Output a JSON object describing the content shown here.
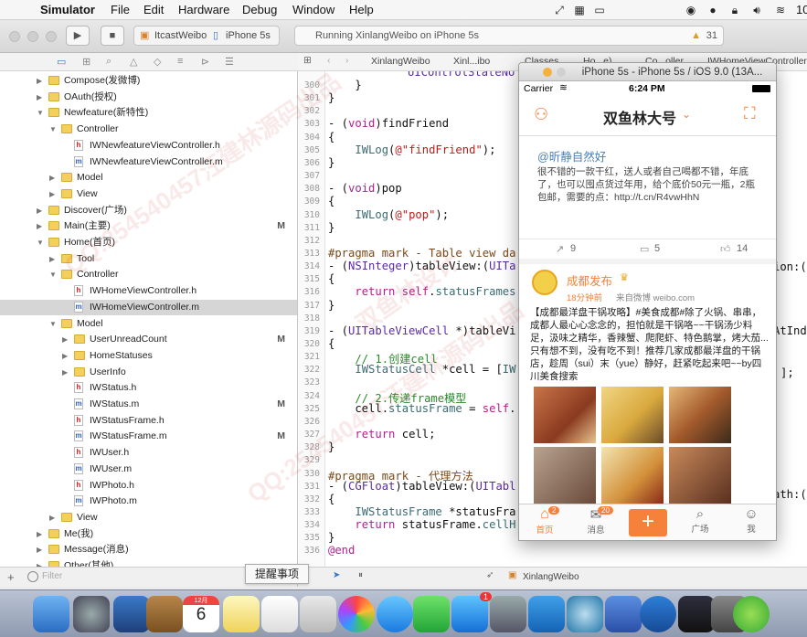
{
  "menubar": {
    "app": "Simulator",
    "items": [
      "File",
      "Edit",
      "Hardware",
      "Debug",
      "Window",
      "Help"
    ],
    "clock_partial": "10"
  },
  "toolbar": {
    "scheme_target": "ItcastWeibo",
    "scheme_device": "iPhone 5s",
    "status_text": "Running XinlangWeibo on iPhone 5s",
    "warning_count": "31"
  },
  "jumpbar": {
    "crumbs": [
      "XinlangWeibo",
      "Xinl...ibo",
      "Classes",
      "Ho...e)",
      "Co...oller",
      "IWHomeViewController..."
    ]
  },
  "navigator": {
    "rows": [
      {
        "label": "Compose(发微博)",
        "type": "folder",
        "indent": 1,
        "tri": "closed",
        "mark": ""
      },
      {
        "label": "OAuth(授权)",
        "type": "folder",
        "indent": 1,
        "tri": "closed",
        "mark": ""
      },
      {
        "label": "Newfeature(新特性)",
        "type": "folder",
        "indent": 1,
        "tri": "open",
        "mark": ""
      },
      {
        "label": "Controller",
        "type": "folder",
        "indent": 2,
        "tri": "open",
        "mark": ""
      },
      {
        "label": "IWNewfeatureViewController.h",
        "type": "h",
        "indent": 3,
        "tri": "",
        "mark": ""
      },
      {
        "label": "IWNewfeatureViewController.m",
        "type": "m",
        "indent": 3,
        "tri": "",
        "mark": ""
      },
      {
        "label": "Model",
        "type": "folder",
        "indent": 2,
        "tri": "closed",
        "mark": ""
      },
      {
        "label": "View",
        "type": "folder",
        "indent": 2,
        "tri": "closed",
        "mark": ""
      },
      {
        "label": "Discover(广场)",
        "type": "folder",
        "indent": 1,
        "tri": "closed",
        "mark": ""
      },
      {
        "label": "Main(主要)",
        "type": "folder",
        "indent": 1,
        "tri": "closed",
        "mark": "M"
      },
      {
        "label": "Home(首页)",
        "type": "folder",
        "indent": 1,
        "tri": "open",
        "mark": ""
      },
      {
        "label": "Tool",
        "type": "folder",
        "indent": 2,
        "tri": "closed",
        "mark": ""
      },
      {
        "label": "Controller",
        "type": "folder",
        "indent": 2,
        "tri": "open",
        "mark": ""
      },
      {
        "label": "IWHomeViewController.h",
        "type": "h",
        "indent": 3,
        "tri": "",
        "mark": ""
      },
      {
        "label": "IWHomeViewController.m",
        "type": "m",
        "indent": 3,
        "tri": "",
        "mark": "",
        "selected": true
      },
      {
        "label": "Model",
        "type": "folder",
        "indent": 2,
        "tri": "open",
        "mark": ""
      },
      {
        "label": "UserUnreadCount",
        "type": "folder",
        "indent": 3,
        "tri": "closed",
        "mark": "M"
      },
      {
        "label": "HomeStatuses",
        "type": "folder",
        "indent": 3,
        "tri": "closed",
        "mark": ""
      },
      {
        "label": "UserInfo",
        "type": "folder",
        "indent": 3,
        "tri": "closed",
        "mark": ""
      },
      {
        "label": "IWStatus.h",
        "type": "h",
        "indent": 3,
        "tri": "",
        "mark": ""
      },
      {
        "label": "IWStatus.m",
        "type": "m",
        "indent": 3,
        "tri": "",
        "mark": "M"
      },
      {
        "label": "IWStatusFrame.h",
        "type": "h",
        "indent": 3,
        "tri": "",
        "mark": ""
      },
      {
        "label": "IWStatusFrame.m",
        "type": "m",
        "indent": 3,
        "tri": "",
        "mark": "M"
      },
      {
        "label": "IWUser.h",
        "type": "h",
        "indent": 3,
        "tri": "",
        "mark": ""
      },
      {
        "label": "IWUser.m",
        "type": "m",
        "indent": 3,
        "tri": "",
        "mark": ""
      },
      {
        "label": "IWPhoto.h",
        "type": "h",
        "indent": 3,
        "tri": "",
        "mark": ""
      },
      {
        "label": "IWPhoto.m",
        "type": "m",
        "indent": 3,
        "tri": "",
        "mark": ""
      },
      {
        "label": "View",
        "type": "folder",
        "indent": 2,
        "tri": "closed",
        "mark": ""
      },
      {
        "label": "Me(我)",
        "type": "folder",
        "indent": 1,
        "tri": "closed",
        "mark": ""
      },
      {
        "label": "Message(消息)",
        "type": "folder",
        "indent": 1,
        "tri": "closed",
        "mark": ""
      },
      {
        "label": "Other(其他)",
        "type": "folder",
        "indent": 1,
        "tri": "closed",
        "mark": ""
      }
    ],
    "filter_placeholder": "Filter"
  },
  "editor": {
    "lines": [
      {
        "n": "300",
        "html": "    }"
      },
      {
        "n": "301",
        "html": "}"
      },
      {
        "n": "302",
        "html": ""
      },
      {
        "n": "303",
        "html": "- (<span class='kw'>void</span>)findFriend"
      },
      {
        "n": "304",
        "html": "{"
      },
      {
        "n": "305",
        "html": "    <span class='mv'>IWLog</span>(<span class='str'>@\"findFriend\"</span>);"
      },
      {
        "n": "306",
        "html": "}"
      },
      {
        "n": "307",
        "html": ""
      },
      {
        "n": "308",
        "html": "- (<span class='kw'>void</span>)pop"
      },
      {
        "n": "309",
        "html": "{"
      },
      {
        "n": "310",
        "html": "    <span class='mv'>IWLog</span>(<span class='str'>@\"pop\"</span>);"
      },
      {
        "n": "311",
        "html": "}"
      },
      {
        "n": "312",
        "html": ""
      },
      {
        "n": "313",
        "html": "<span class='pr'>#pragma mark - Table view da</span>"
      },
      {
        "n": "314",
        "html": "- (<span class='ty'>NSInteger</span>)tableView:(<span class='ty'>UITa</span>"
      },
      {
        "n": "315",
        "html": "{"
      },
      {
        "n": "316",
        "html": "    <span class='kw'>return</span> <span class='kw'>self</span>.<span class='mv'>statusFrames</span>"
      },
      {
        "n": "317",
        "html": "}"
      },
      {
        "n": "318",
        "html": ""
      },
      {
        "n": "319",
        "html": "- (<span class='ty'>UITableViewCell</span> *)tableVi"
      },
      {
        "n": "320",
        "html": "{"
      },
      {
        "n": "321",
        "html": "    <span class='cm'>// 1.创建cell</span>"
      },
      {
        "n": "322",
        "html": "    <span class='mv'>IWStatusCell</span> *cell = [<span class='mv'>IW</span>"
      },
      {
        "n": "323",
        "html": ""
      },
      {
        "n": "324",
        "html": "    <span class='cm'>// 2.传递frame模型</span>"
      },
      {
        "n": "325",
        "html": "    cell.<span class='mv'>statusFrame</span> = <span class='kw'>self</span>."
      },
      {
        "n": "326",
        "html": ""
      },
      {
        "n": "327",
        "html": "    <span class='kw'>return</span> cell;"
      },
      {
        "n": "328",
        "html": "}"
      },
      {
        "n": "329",
        "html": ""
      },
      {
        "n": "330",
        "html": "<span class='pr'>#pragma mark - 代理方法</span>"
      },
      {
        "n": "331",
        "html": "- (<span class='ty'>CGFloat</span>)tableView:(<span class='ty'>UITabl</span>"
      },
      {
        "n": "332",
        "html": "{"
      },
      {
        "n": "333",
        "html": "    <span class='mv'>IWStatusFrame</span> *statusFra"
      },
      {
        "n": "334",
        "html": "    <span class='kw'>return</span> statusFrame.<span class='mv'>cellH</span>"
      },
      {
        "n": "335",
        "html": "}"
      },
      {
        "n": "336",
        "html": "<span class='kw'>@end</span>"
      }
    ],
    "right_fragments": {
      "l299": "UIControlStateNo",
      "l314": "ion:(",
      "l319": "AtInd",
      "l322": "];",
      "l331": "ath:("
    }
  },
  "debugbar": {
    "target": "XinlangWeibo"
  },
  "tooltip": "提醒事项",
  "simulator": {
    "title": "iPhone 5s - iPhone 5s / iOS 9.0 (13A...",
    "carrier": "Carrier",
    "time": "6:24 PM",
    "nav_title": "双鱼林大号",
    "card1": {
      "user": "@昕静自然好",
      "text": "很不错的一款干红，送人或者自己喝都不错，年底了，也可以囤点货过年用，给个底价50元一瓶，2瓶包邮，需要的点：http://t.cn/R4vwHhN",
      "reposts": "9",
      "comments": "5",
      "likes": "14"
    },
    "card2": {
      "name": "成都发布",
      "time": "18分钟前",
      "source": "来自微博 weibo.com",
      "text": "【成都最洋盘干锅攻略】#美食成都#除了火锅、串串，成都人最心心念念的，担怕就是干锅咯~~干锅汤少料足，汲味之精华，香辣蟹、爬爬虾、特色鹅掌，烤大茄...只有想不到，没有吃不到！推荐几家成都最洋盘的干锅店，趁周（sui）末（yue）静好，赶紧吃起来吧~~by四川美食搜索"
    },
    "tabs": [
      {
        "label": "首页",
        "badge": "2"
      },
      {
        "label": "消息",
        "badge": "20"
      },
      {
        "label": "",
        "badge": ""
      },
      {
        "label": "广场",
        "badge": ""
      },
      {
        "label": "我",
        "badge": ""
      }
    ]
  },
  "dock": {
    "calendar_month": "12月",
    "calendar_day": "6",
    "appstore_badge": "1"
  },
  "watermark": [
    "QQ:254540457汪建林源码出品",
    "双鱼林设计",
    "QQ:254540457汪建林源码出品"
  ],
  "colors": {
    "accent_orange": "#f5813a",
    "selection": "#d6d6d6",
    "keyword": "#b0218f"
  }
}
